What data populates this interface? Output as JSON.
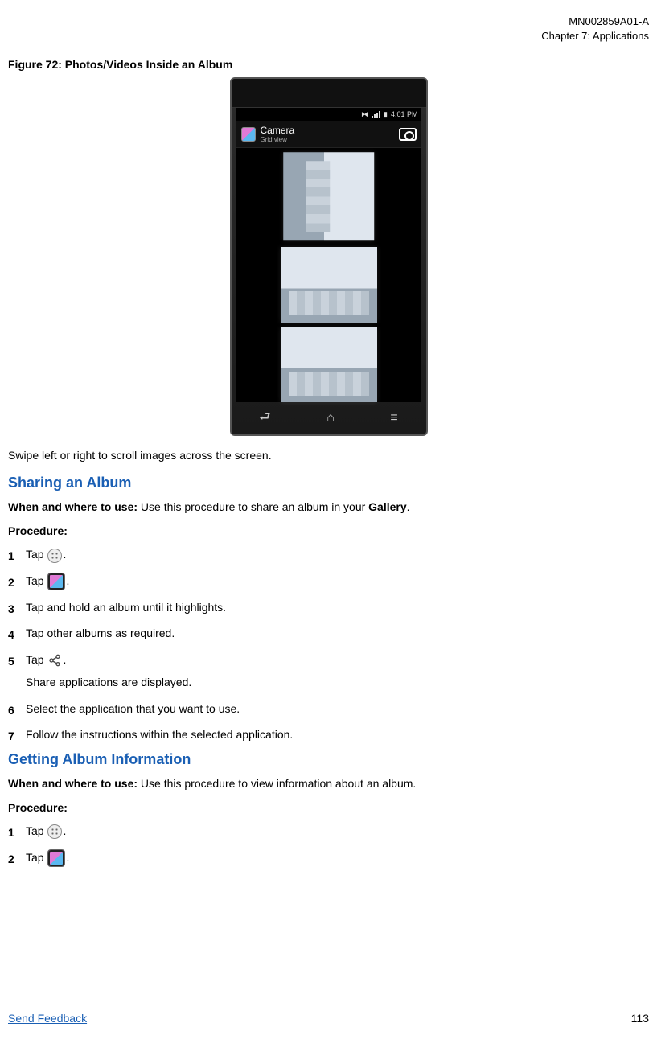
{
  "header": {
    "doc_id": "MN002859A01-A",
    "chapter": "Chapter 7:  Applications"
  },
  "figure": {
    "caption": "Figure 72: Photos/Videos Inside an Album",
    "statusbar_time": "4:01 PM",
    "app_title": "Camera",
    "app_subtitle": "Grid view"
  },
  "swipe_text": "Swipe left or right to scroll images across the screen.",
  "section1": {
    "title": "Sharing an Album",
    "when_label": "When and where to use:",
    "when_text": " Use this procedure to share an album in your ",
    "when_bold": "Gallery",
    "when_tail": ".",
    "procedure_label": "Procedure:",
    "steps": {
      "s1_pre": "Tap ",
      "s1_post": ".",
      "s2_pre": "Tap ",
      "s2_post": ".",
      "s3": "Tap and hold an album until it highlights.",
      "s4": "Tap other albums as required.",
      "s5_pre": "Tap ",
      "s5_post": ".",
      "s5_sub": "Share applications are displayed.",
      "s6": "Select the application that you want to use.",
      "s7": "Follow the instructions within the selected application."
    }
  },
  "section2": {
    "title": "Getting Album Information",
    "when_label": "When and where to use:",
    "when_text": " Use this procedure to view information about an album.",
    "procedure_label": "Procedure:",
    "steps": {
      "s1_pre": "Tap ",
      "s1_post": ".",
      "s2_pre": "Tap ",
      "s2_post": "."
    }
  },
  "footer": {
    "link": "Send Feedback",
    "page": "113"
  }
}
